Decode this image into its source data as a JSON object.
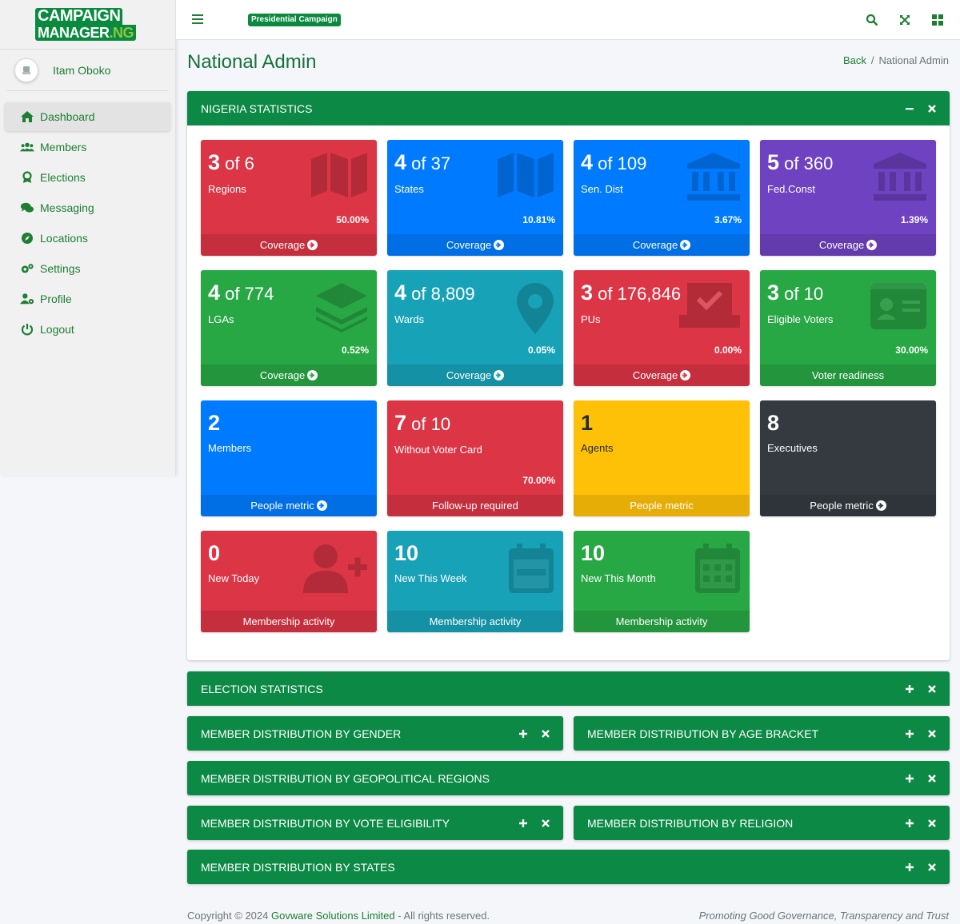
{
  "brand": {
    "line1_a": "CAMP",
    "line1_b": "AIGN",
    "line2_a": "MAN",
    "line2_b": "AGER",
    "line2_c": ".NG"
  },
  "user": {
    "name": "Itam Oboko"
  },
  "sidebar": {
    "items": [
      {
        "label": "Dashboard"
      },
      {
        "label": "Members"
      },
      {
        "label": "Elections"
      },
      {
        "label": "Messaging"
      },
      {
        "label": "Locations"
      },
      {
        "label": "Settings"
      },
      {
        "label": "Profile"
      },
      {
        "label": "Logout"
      }
    ]
  },
  "topbar": {
    "badge": "Presidential Campaign"
  },
  "header": {
    "title": "National Admin",
    "crumb_back": "Back",
    "crumb_sep": "/",
    "crumb_current": "National Admin"
  },
  "nigeria": {
    "title": "NIGERIA STATISTICS"
  },
  "boxes": [
    {
      "num": "3",
      "of": "of 6",
      "label": "Regions",
      "pct": "50.00%",
      "foot": "Coverage",
      "color": "#dc3545",
      "icon": "map-icon"
    },
    {
      "num": "4",
      "of": "of 37",
      "label": "States",
      "pct": "10.81%",
      "foot": "Coverage",
      "color": "#007bff",
      "icon": "map-icon"
    },
    {
      "num": "4",
      "of": "of 109",
      "label": "Sen. Dist",
      "pct": "3.67%",
      "foot": "Coverage",
      "color": "#007bff",
      "icon": "landmark-icon"
    },
    {
      "num": "5",
      "of": "of 360",
      "label": "Fed.Const",
      "pct": "1.39%",
      "foot": "Coverage",
      "color": "#6f42c1",
      "icon": "landmark-icon"
    },
    {
      "num": "4",
      "of": "of 774",
      "label": "LGAs",
      "pct": "0.52%",
      "foot": "Coverage",
      "color": "#28a745",
      "icon": "layers-icon"
    },
    {
      "num": "4",
      "of": "of 8,809",
      "label": "Wards",
      "pct": "0.05%",
      "foot": "Coverage",
      "color": "#17a2b8",
      "icon": "map-marker-icon"
    },
    {
      "num": "3",
      "of": "of 176,846",
      "label": "PUs",
      "pct": "0.00%",
      "foot": "Coverage",
      "color": "#dc3545",
      "icon": "vote-box-icon"
    },
    {
      "num": "3",
      "of": "of 10",
      "label": "Eligible Voters",
      "pct": "30.00%",
      "foot": "Voter readiness",
      "color": "#28a745",
      "icon": "id-card-icon"
    },
    {
      "num": "2",
      "of": "",
      "label": "Members",
      "pct": "",
      "foot": "People metric",
      "color": "#007bff",
      "icon": ""
    },
    {
      "num": "7",
      "of": "of 10",
      "label": "Without Voter Card",
      "pct": "70.00%",
      "foot": "Follow-up required",
      "color": "#dc3545",
      "icon": ""
    },
    {
      "num": "1",
      "of": "",
      "label": "Agents",
      "pct": "",
      "foot": "People metric",
      "color": "#ffc107",
      "icon": ""
    },
    {
      "num": "8",
      "of": "",
      "label": "Executives",
      "pct": "",
      "foot": "People metric",
      "color": "#343a40",
      "icon": ""
    },
    {
      "num": "0",
      "of": "",
      "label": "New Today",
      "pct": "",
      "foot": "Membership activity",
      "color": "#dc3545",
      "icon": "user-plus-icon"
    },
    {
      "num": "10",
      "of": "",
      "label": "New This Week",
      "pct": "",
      "foot": "Membership activity",
      "color": "#17a2b8",
      "icon": "calendar-week-icon"
    },
    {
      "num": "10",
      "of": "",
      "label": "New This Month",
      "pct": "",
      "foot": "Membership activity",
      "color": "#28a745",
      "icon": "calendar-month-icon"
    }
  ],
  "panels": {
    "election": "ELECTION STATISTICS",
    "gender": "MEMBER DISTRIBUTION BY GENDER",
    "age": "MEMBER DISTRIBUTION BY AGE BRACKET",
    "geo": "MEMBER DISTRIBUTION BY GEOPOLITICAL REGIONS",
    "vote": "MEMBER DISTRIBUTION BY VOTE ELIGIBILITY",
    "religion": "MEMBER DISTRIBUTION BY RELIGION",
    "states": "MEMBER DISTRIBUTION BY STATES"
  },
  "footer": {
    "copy": "Copyright © 2024",
    "company": "Govware Solutions Limited",
    "rights": "- All rights reserved.",
    "tagline": "Promoting Good Governance, Transparency and Trust"
  }
}
